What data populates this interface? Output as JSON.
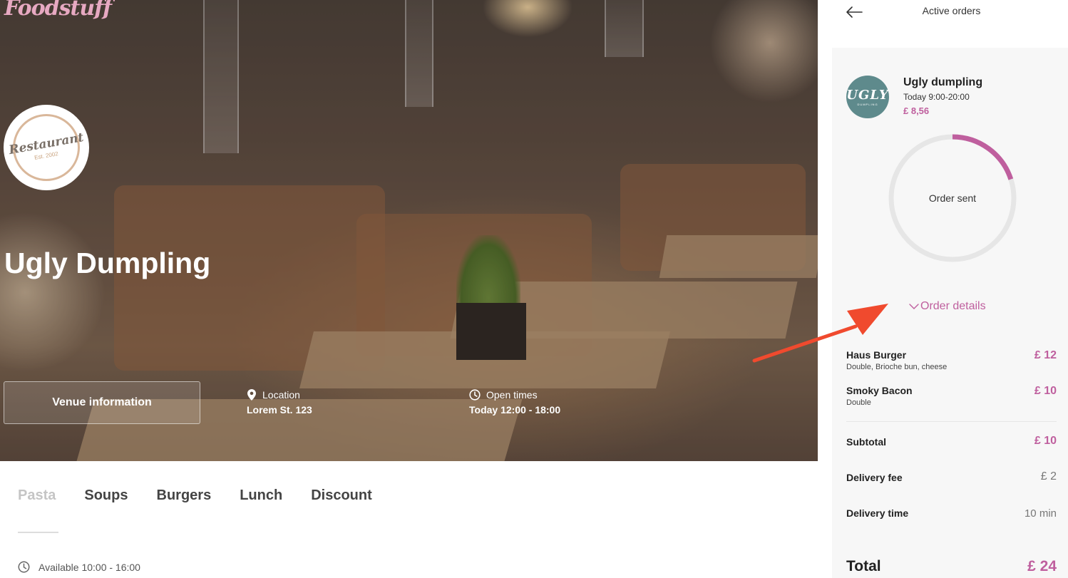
{
  "brand": {
    "name": "Foodstuff"
  },
  "hero": {
    "logo_text": "Restaurant",
    "logo_sub": "Est. 2002",
    "venue_name": "Ugly Dumpling",
    "venue_button": "Venue information",
    "location_label": "Location",
    "location_value": "Lorem St. 123",
    "open_label": "Open times",
    "open_value": "Today 12:00 - 18:00"
  },
  "tabs": [
    {
      "label": "Pasta",
      "active": true
    },
    {
      "label": "Soups"
    },
    {
      "label": "Burgers"
    },
    {
      "label": "Lunch"
    },
    {
      "label": "Discount"
    }
  ],
  "availability": "Available 10:00 - 16:00",
  "panel": {
    "title": "Active orders",
    "venue": {
      "avatar_text": "UGLY",
      "avatar_sub": "DUMPLING",
      "name": "Ugly dumpling",
      "hours": "Today 9:00-20:00",
      "price": "£ 8,56"
    },
    "status_label": "Order sent",
    "progress_fraction": 0.2,
    "order_details_label": "Order details",
    "items": [
      {
        "name": "Haus Burger",
        "desc": "Double, Brioche bun, cheese",
        "price": "£ 12"
      },
      {
        "name": "Smoky Bacon",
        "desc": "Double",
        "price": "£ 10"
      }
    ],
    "subtotal_label": "Subtotal",
    "subtotal_value": "£ 10",
    "fee_label": "Delivery fee",
    "fee_value": "£ 2",
    "time_label": "Delivery time",
    "time_value": "10 min",
    "total_label": "Total",
    "total_value": "£ 24"
  },
  "colors": {
    "accent": "#bf5f9e",
    "annotation": "#f04a2e",
    "avatar": "#5e8a8c"
  }
}
